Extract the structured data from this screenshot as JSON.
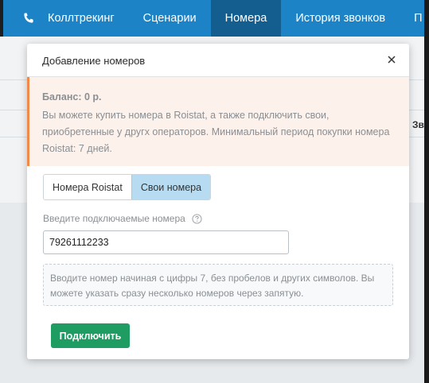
{
  "nav": {
    "items": [
      {
        "label": "Коллтрекинг"
      },
      {
        "label": "Сценарии"
      },
      {
        "label": "Номера"
      },
      {
        "label": "История звонков"
      },
      {
        "label": "П"
      }
    ],
    "active_index": 2,
    "color": "#1c83c6",
    "active_color": "#145e8f"
  },
  "background": {
    "column_header_fragment": "Зво"
  },
  "modal": {
    "title": "Добавление номеров",
    "alert": {
      "balance": "Баланс: 0 р.",
      "text": "Вы можете купить номера в Roistat, а также подключить свои, приобретенные у другх операторов. Минимальный период покупки номера Roistat: 7 дней.",
      "accent_color": "#ef8a4c"
    },
    "tabs": [
      {
        "label": "Номера Roistat",
        "active": false
      },
      {
        "label": "Свои номера",
        "active": true
      }
    ],
    "field_label": "Введите подключаемые номера",
    "input_value": "79261112233",
    "hint": "Вводите номер начиная с цифры 7, без пробелов и других символов. Вы можете указать сразу несколько номеров через запятую.",
    "submit_label": "Подключить",
    "submit_color": "#1f9c61"
  }
}
